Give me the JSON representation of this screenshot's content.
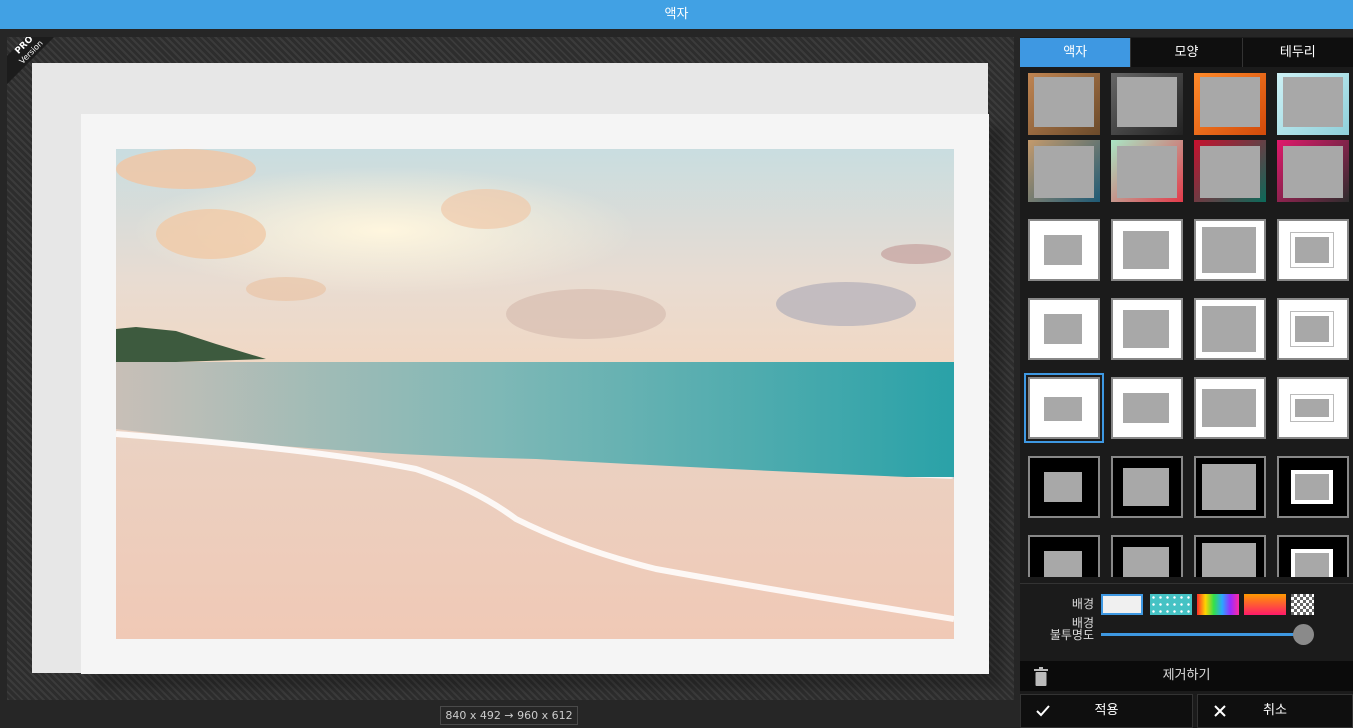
{
  "title": "액자",
  "pro_badge": {
    "line1": "PRO",
    "line2": "Version"
  },
  "size_info": "840 x 492 → 960 x 612",
  "tabs": [
    "액자",
    "모양",
    "테두리"
  ],
  "active_tab": 0,
  "background_label": "배경",
  "opacity_label_line1": "배경",
  "opacity_label_line2": "불투명도",
  "opacity_value": 1.0,
  "remove_label": "제거하기",
  "apply_label": "적용",
  "cancel_label": "취소",
  "colors": {
    "accent": "#3e98e2",
    "titlebar": "#41a1e4"
  },
  "swatches": [
    "white",
    "teal-dots",
    "rainbow",
    "red-orange-gradient",
    "transparent-checker"
  ],
  "selected_swatch": 0,
  "selected_frame": "row5-col1"
}
